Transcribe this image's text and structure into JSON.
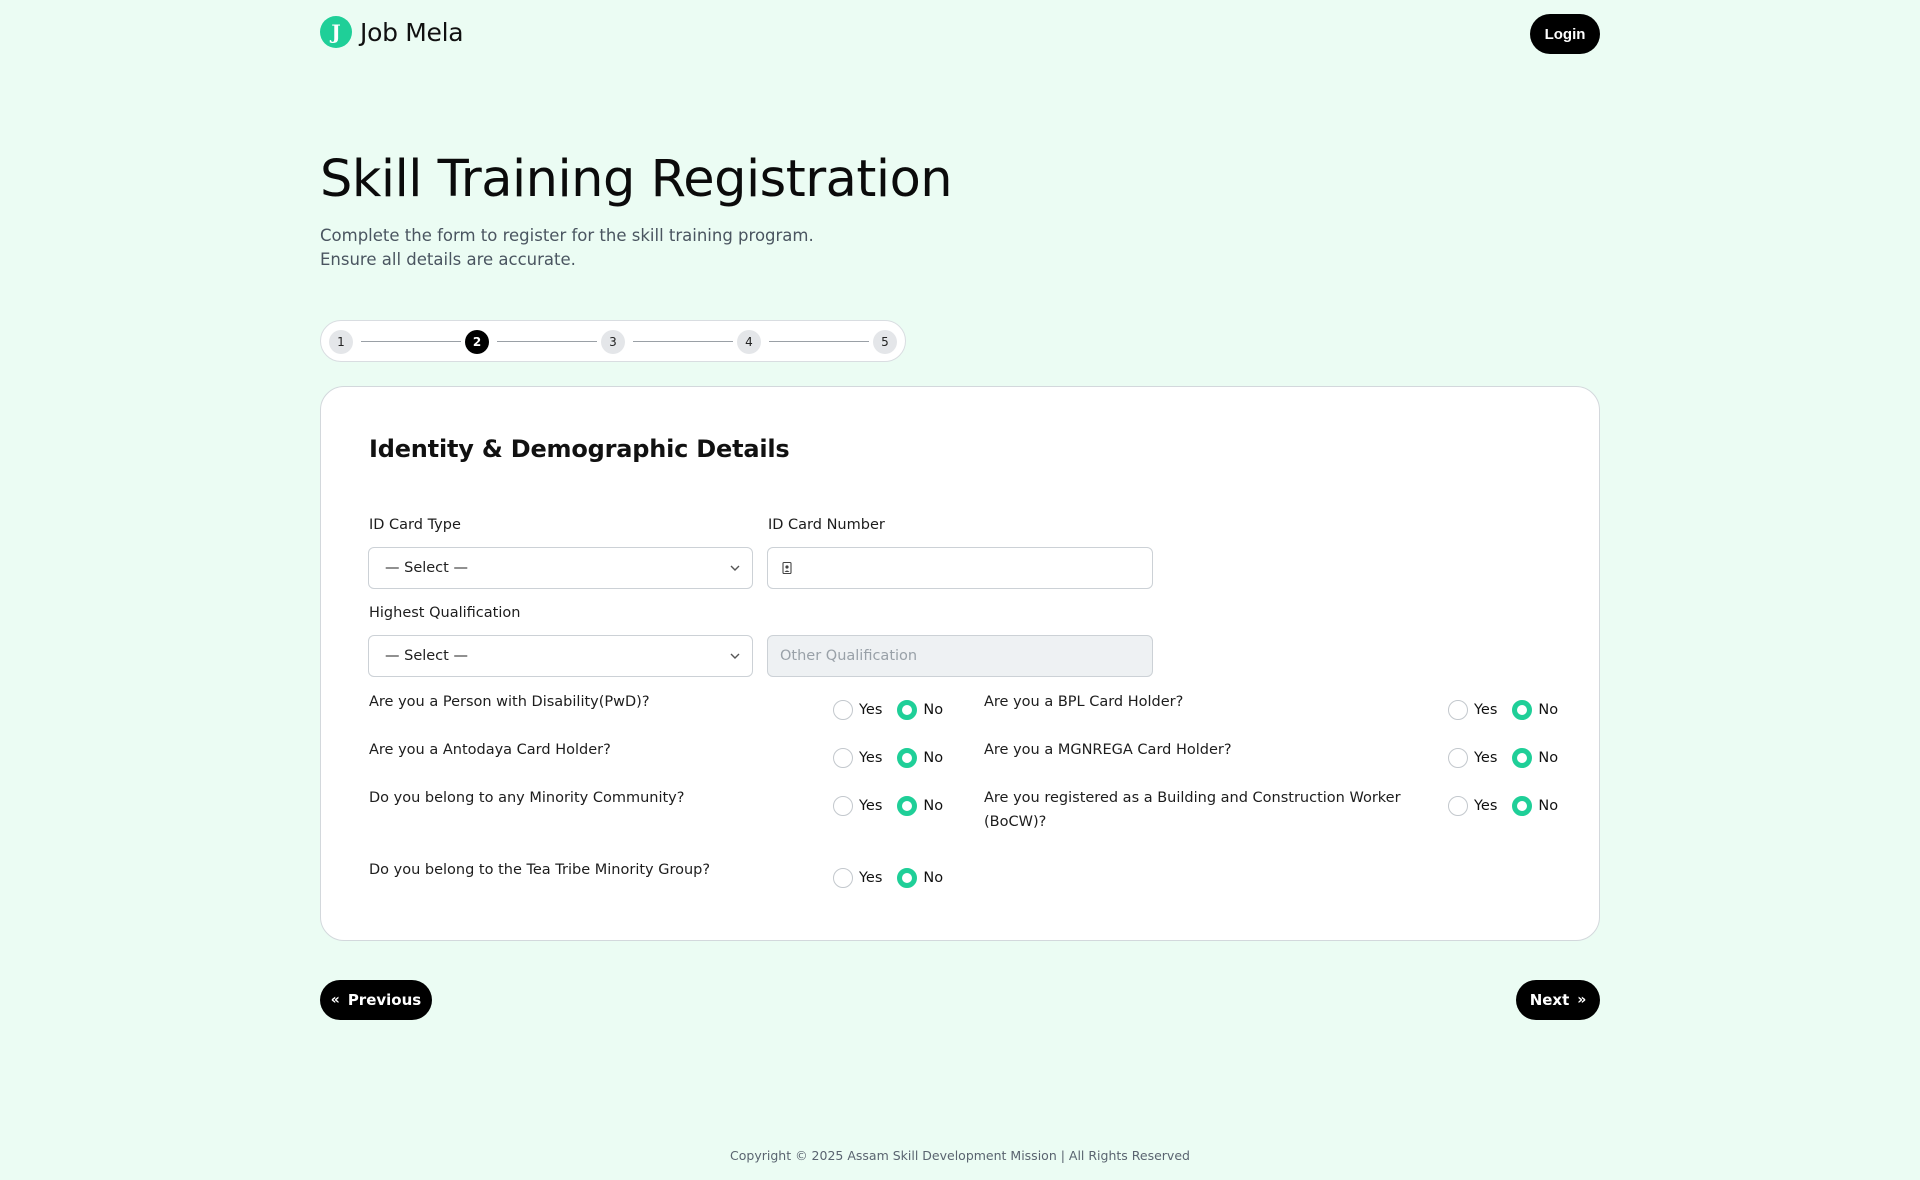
{
  "header": {
    "logo_letter": "J",
    "logo_text": "Job Mela",
    "login_label": "Login"
  },
  "page": {
    "title": "Skill Training Registration",
    "subtitle_line1": "Complete the form to register for the skill training program.",
    "subtitle_line2": "Ensure all details are accurate."
  },
  "stepper": {
    "steps": [
      "1",
      "2",
      "3",
      "4",
      "5"
    ],
    "active_step": "2"
  },
  "form": {
    "section_title": "Identity & Demographic Details",
    "id_card_type": {
      "label": "ID Card Type",
      "value": "— Select —"
    },
    "id_card_number": {
      "label": "ID Card Number",
      "value": ""
    },
    "highest_qualification": {
      "label": "Highest Qualification",
      "value": "— Select —"
    },
    "other_qualification": {
      "placeholder": "Other Qualification"
    },
    "yes_label": "Yes",
    "no_label": "No",
    "questions": [
      {
        "text": "Are you a Person with Disability(PwD)?",
        "answer": "No"
      },
      {
        "text": "Are you a BPL Card Holder?",
        "answer": "No"
      },
      {
        "text": "Are you a Antodaya Card Holder?",
        "answer": "No"
      },
      {
        "text": "Are you a MGNREGA Card Holder?",
        "answer": "No"
      },
      {
        "text": "Do you belong to any Minority Community?",
        "answer": "No"
      },
      {
        "text_line1": "Are you registered as a Building and Construction Worker",
        "text_line2": "(BoCW)?",
        "answer": "No"
      },
      {
        "text": "Do you belong to the Tea Tribe Minority Group?",
        "answer": "No"
      }
    ]
  },
  "nav": {
    "previous_label": "Previous",
    "next_label": "Next"
  },
  "footer": {
    "copyright": "Copyright © 2025 Assam Skill Development Mission | All Rights Reserved"
  },
  "colors": {
    "accent": "#1fcf98",
    "background": "#ebfcf3",
    "button": "#000000"
  }
}
